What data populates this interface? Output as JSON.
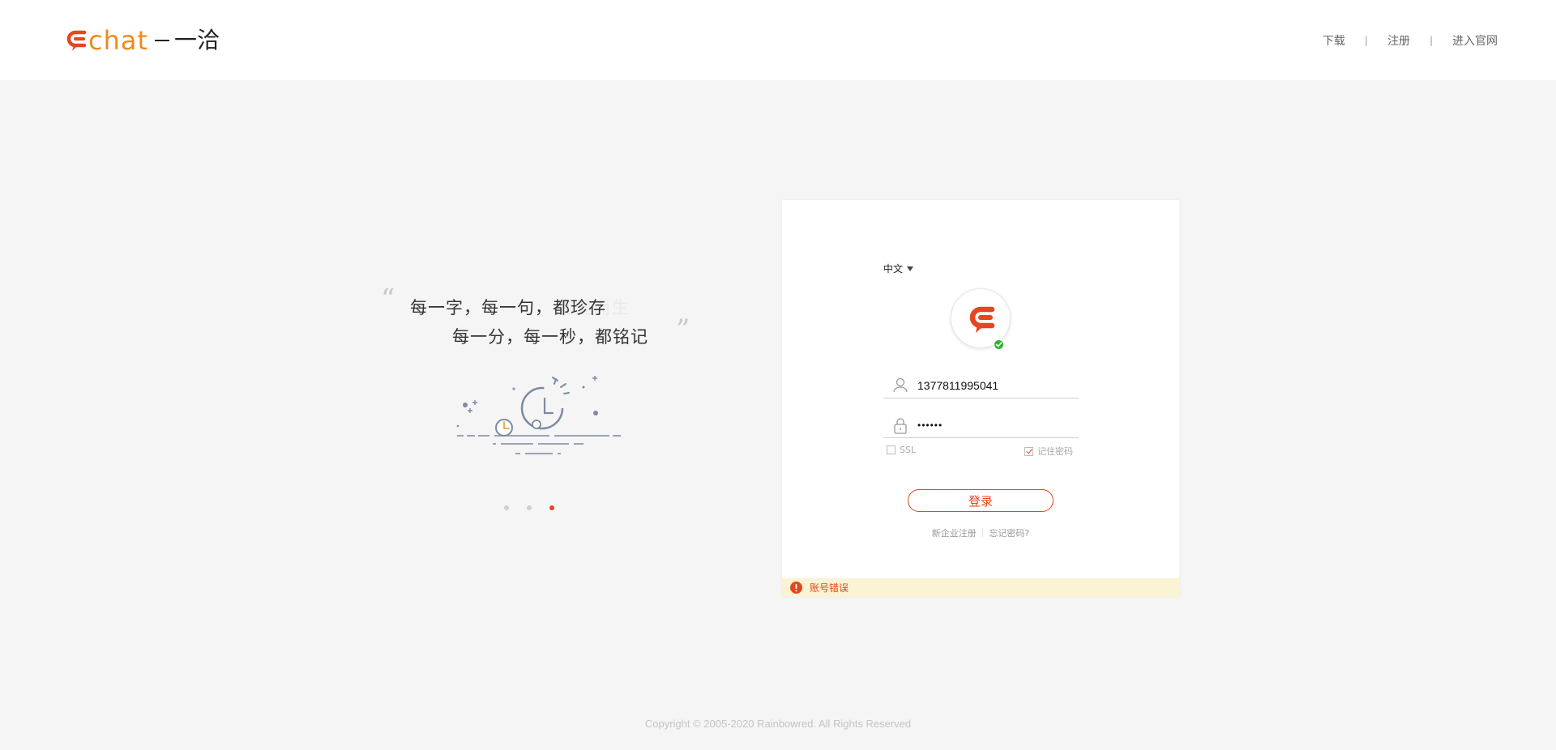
{
  "header": {
    "logo_chat": "chat",
    "logo_cn": "一洽",
    "nav": {
      "download": "下载",
      "register": "注册",
      "website": "进入官网",
      "divider": "|"
    }
  },
  "slogan": {
    "line1": "每一字，每一句，都珍存",
    "line2": "每一分，每一秒，都铭记",
    "ghost_text": "因爱而生",
    "quote_open": "“",
    "quote_close": "”"
  },
  "carousel": {
    "count": 3,
    "active_index": 2
  },
  "login": {
    "language": "中文",
    "username": "13778119950​41",
    "password_masked": "••••••",
    "ssl_label": "SSL",
    "ssl_checked": false,
    "remember_label": "记住密码",
    "remember_checked": true,
    "login_button": "登录",
    "register_link": "新企业注册",
    "link_divider": "|",
    "forgot_link": "忘记密码?",
    "error_message": "账号错误",
    "online_status": "online"
  },
  "footer": {
    "copyright": "Copyright © 2005-2020 Rainbowred. All Rights Reserved"
  },
  "colors": {
    "brand_red": "#e5461f",
    "brand_orange": "#f08a1c",
    "status_green": "#2ab52a",
    "error_bg": "#faf3d4"
  }
}
